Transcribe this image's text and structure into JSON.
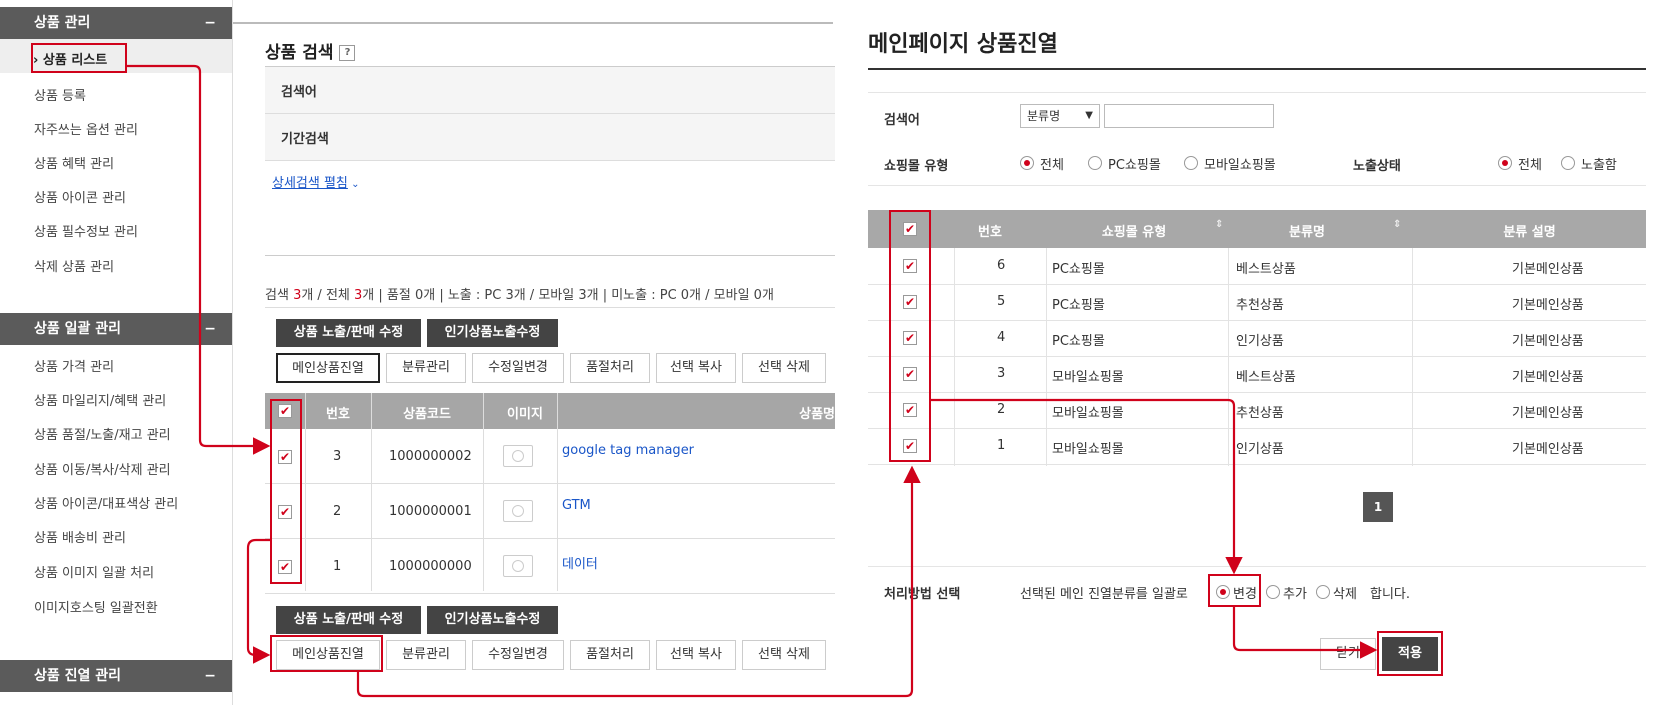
{
  "sidebar": {
    "groups": [
      {
        "title": "상품 관리",
        "toggle": "−",
        "items": [
          "› 상품 리스트",
          "상품 등록",
          "자주쓰는 옵션 관리",
          "상품 혜택 관리",
          "상품 아이콘 관리",
          "상품 필수정보 관리",
          "삭제 상품 관리"
        ]
      },
      {
        "title": "상품 일괄 관리",
        "toggle": "−",
        "items": [
          "상품 가격 관리",
          "상품 마일리지/혜택 관리",
          "상품 품절/노출/재고 관리",
          "상품 이동/복사/삭제 관리",
          "상품 아이콘/대표색상 관리",
          "상품 배송비 관리",
          "상품 이미지 일괄 처리",
          "이미지호스팅 일괄전환"
        ]
      },
      {
        "title": "상품 진열 관리",
        "toggle": "−"
      }
    ]
  },
  "search": {
    "title": "상품 검색",
    "help": "?",
    "rows": [
      "검색어",
      "기간검색"
    ],
    "detail_link": "상세검색 펼침"
  },
  "summary": {
    "parts": [
      "검색 ",
      "3",
      "개 / 전체 ",
      "3",
      "개 | 품절 0개 | 노출 : PC 3개 / 모바일 3개 | 미노출 : PC 0개 / 모바일 0개"
    ]
  },
  "actions": {
    "dark": [
      "상품 노출/판매 수정",
      "인기상품노출수정"
    ],
    "light": [
      "메인상품진열",
      "분류관리",
      "수정일변경",
      "품절처리",
      "선택 복사",
      "선택 삭제"
    ]
  },
  "product_table": {
    "headers": [
      "번호",
      "상품코드",
      "이미지",
      "상품명"
    ],
    "rows": [
      {
        "no": "3",
        "code": "1000000002",
        "name": "google tag manager"
      },
      {
        "no": "2",
        "code": "1000000001",
        "name": "GTM"
      },
      {
        "no": "1",
        "code": "1000000000",
        "name": "데이터"
      }
    ]
  },
  "dialog": {
    "title": "메인페이지 상품진열",
    "search_label": "검색어",
    "search_select": "분류명",
    "shop_type_label": "쇼핑몰 유형",
    "shop_type_options": [
      "전체",
      "PC쇼핑몰",
      "모바일쇼핑몰"
    ],
    "exposure_label": "노출상태",
    "exposure_options": [
      "전체",
      "노출함"
    ],
    "table_headers": [
      "번호",
      "쇼핑몰 유형",
      "분류명",
      "분류 설명"
    ],
    "rows": [
      {
        "no": "6",
        "shop": "PC쇼핑몰",
        "category": "베스트상품",
        "desc": "기본메인상품"
      },
      {
        "no": "5",
        "shop": "PC쇼핑몰",
        "category": "추천상품",
        "desc": "기본메인상품"
      },
      {
        "no": "4",
        "shop": "PC쇼핑몰",
        "category": "인기상품",
        "desc": "기본메인상품"
      },
      {
        "no": "3",
        "shop": "모바일쇼핑몰",
        "category": "베스트상품",
        "desc": "기본메인상품"
      },
      {
        "no": "2",
        "shop": "모바일쇼핑몰",
        "category": "추천상품",
        "desc": "기본메인상품"
      },
      {
        "no": "1",
        "shop": "모바일쇼핑몰",
        "category": "인기상품",
        "desc": "기본메인상품"
      }
    ],
    "page": "1",
    "method_label": "처리방법 선택",
    "method_prefix": "선택된 메인 진열분류를 일괄로",
    "method_options": [
      "변경",
      "추가",
      "삭제"
    ],
    "method_suffix": "합니다.",
    "close_label": "닫기",
    "apply_label": "적용"
  },
  "colors": {
    "accent_red": "#d0021b",
    "header_gray": "#a6a6a6",
    "dark_button": "#444444",
    "link_blue": "#1a56c8"
  }
}
